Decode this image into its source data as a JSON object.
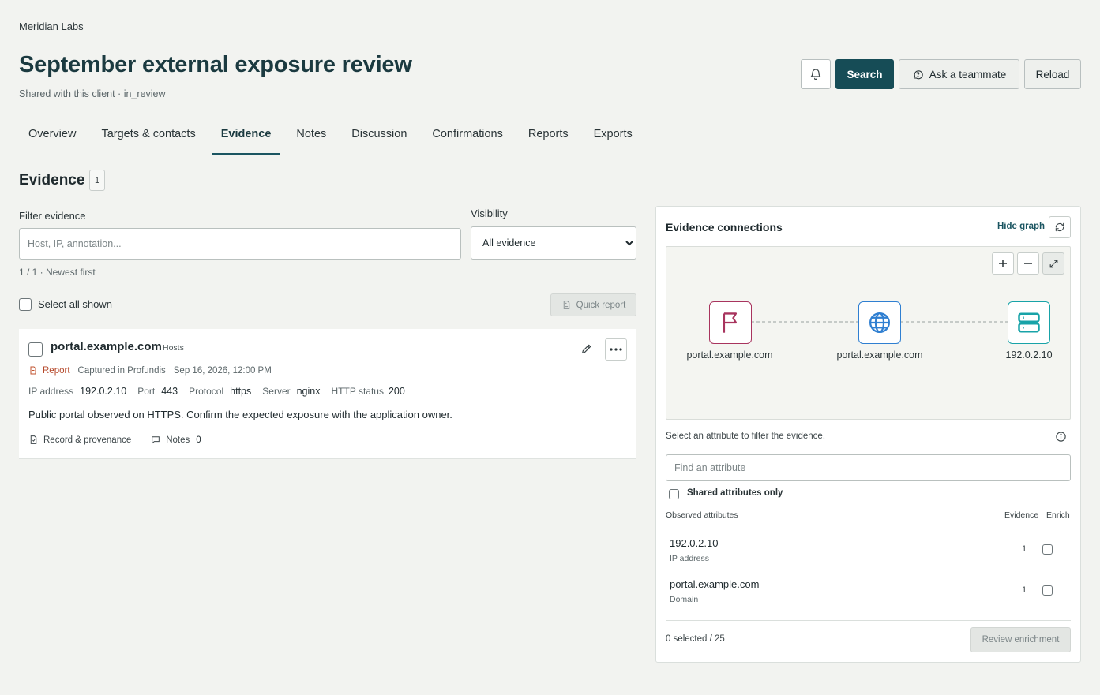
{
  "header": {
    "org": "Meridian Labs",
    "title": "September external exposure review",
    "subtitle": "Shared with this client · in_review",
    "search_label": "Search",
    "ask_label": "Ask a teammate",
    "reload_label": "Reload"
  },
  "tabs": [
    {
      "label": "Overview"
    },
    {
      "label": "Targets & contacts"
    },
    {
      "label": "Evidence",
      "active": true
    },
    {
      "label": "Notes"
    },
    {
      "label": "Discussion"
    },
    {
      "label": "Confirmations"
    },
    {
      "label": "Reports"
    },
    {
      "label": "Exports"
    }
  ],
  "evidence": {
    "heading": "Evidence",
    "count": "1",
    "filter_label": "Filter evidence",
    "filter_placeholder": "Host, IP, annotation...",
    "visibility_label": "Visibility",
    "visibility_selected": "All evidence",
    "meta": "1 / 1 · Newest first",
    "select_all_label": "Select all shown",
    "quick_report_label": "Quick report",
    "item": {
      "host": "portal.example.com",
      "category": "Hosts",
      "report_label": "Report",
      "captured": "Captured in Profundis",
      "date": "Sep 16, 2026, 12:00 PM",
      "fields": [
        {
          "key": "IP address",
          "value": "192.0.2.10"
        },
        {
          "key": "Port",
          "value": "443"
        },
        {
          "key": "Protocol",
          "value": "https"
        },
        {
          "key": "Server",
          "value": "nginx"
        },
        {
          "key": "HTTP status",
          "value": "200"
        }
      ],
      "description": "Public portal observed on HTTPS. Confirm the expected exposure with the application owner.",
      "record_label": "Record & provenance",
      "notes_label": "Notes",
      "notes_count": "0"
    }
  },
  "connections": {
    "title": "Evidence connections",
    "hide_graph_label": "Hide graph",
    "nodes": [
      {
        "label": "portal.example.com",
        "icon": "flag-icon",
        "color": "#a8345e"
      },
      {
        "label": "portal.example.com",
        "icon": "globe-icon",
        "color": "#2f7fd1"
      },
      {
        "label": "192.0.2.10",
        "icon": "server-icon",
        "color": "#18a3a8"
      }
    ],
    "filter_hint": "Select an attribute to filter the evidence.",
    "attr_placeholder": "Find an attribute",
    "shared_only_label": "Shared attributes only",
    "col_attr": "Observed attributes",
    "col_evidence": "Evidence",
    "col_enrich": "Enrich",
    "rows": [
      {
        "value": "192.0.2.10",
        "type": "IP address",
        "count": "1"
      },
      {
        "value": "portal.example.com",
        "type": "Domain",
        "count": "1"
      }
    ],
    "selected_text": "0 selected / 25",
    "review_label": "Review enrichment"
  }
}
